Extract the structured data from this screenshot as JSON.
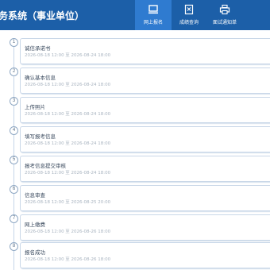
{
  "header": {
    "title": "务系统（事业单位）",
    "nav": [
      {
        "label": "网上报名",
        "icon": "monitor-icon",
        "active": true
      },
      {
        "label": "成绩查询",
        "icon": "grade-document-icon",
        "active": false
      },
      {
        "label": "面试通知单",
        "icon": "printer-icon",
        "active": false
      }
    ]
  },
  "steps": [
    {
      "num": "1",
      "title": "诚信承诺书",
      "time": "2026-08-18 12:00 至 2026-08-24 18:00"
    },
    {
      "num": "2",
      "title": "确认基本信息",
      "time": "2026-08-18 12:00 至 2026-08-24 18:00"
    },
    {
      "num": "3",
      "title": "上传照片",
      "time": "2026-08-18 12:00 至 2026-08-24 18:00"
    },
    {
      "num": "4",
      "title": "填写报考信息",
      "time": "2026-08-18 12:00 至 2026-08-24 18:00"
    },
    {
      "num": "5",
      "title": "报考信息提交审核",
      "time": "2026-08-18 12:00 至 2026-08-24 18:00"
    },
    {
      "num": "6",
      "title": "信息审查",
      "time": "2026-08-18 12:00 至 2026-08-25 20:00"
    },
    {
      "num": "7",
      "title": "网上缴费",
      "time": "2026-08-18 12:00 至 2026-08-26 18:00"
    },
    {
      "num": "8",
      "title": "报名成功",
      "time": "2026-08-18 12:00 至 2026-08-26 18:00"
    }
  ]
}
